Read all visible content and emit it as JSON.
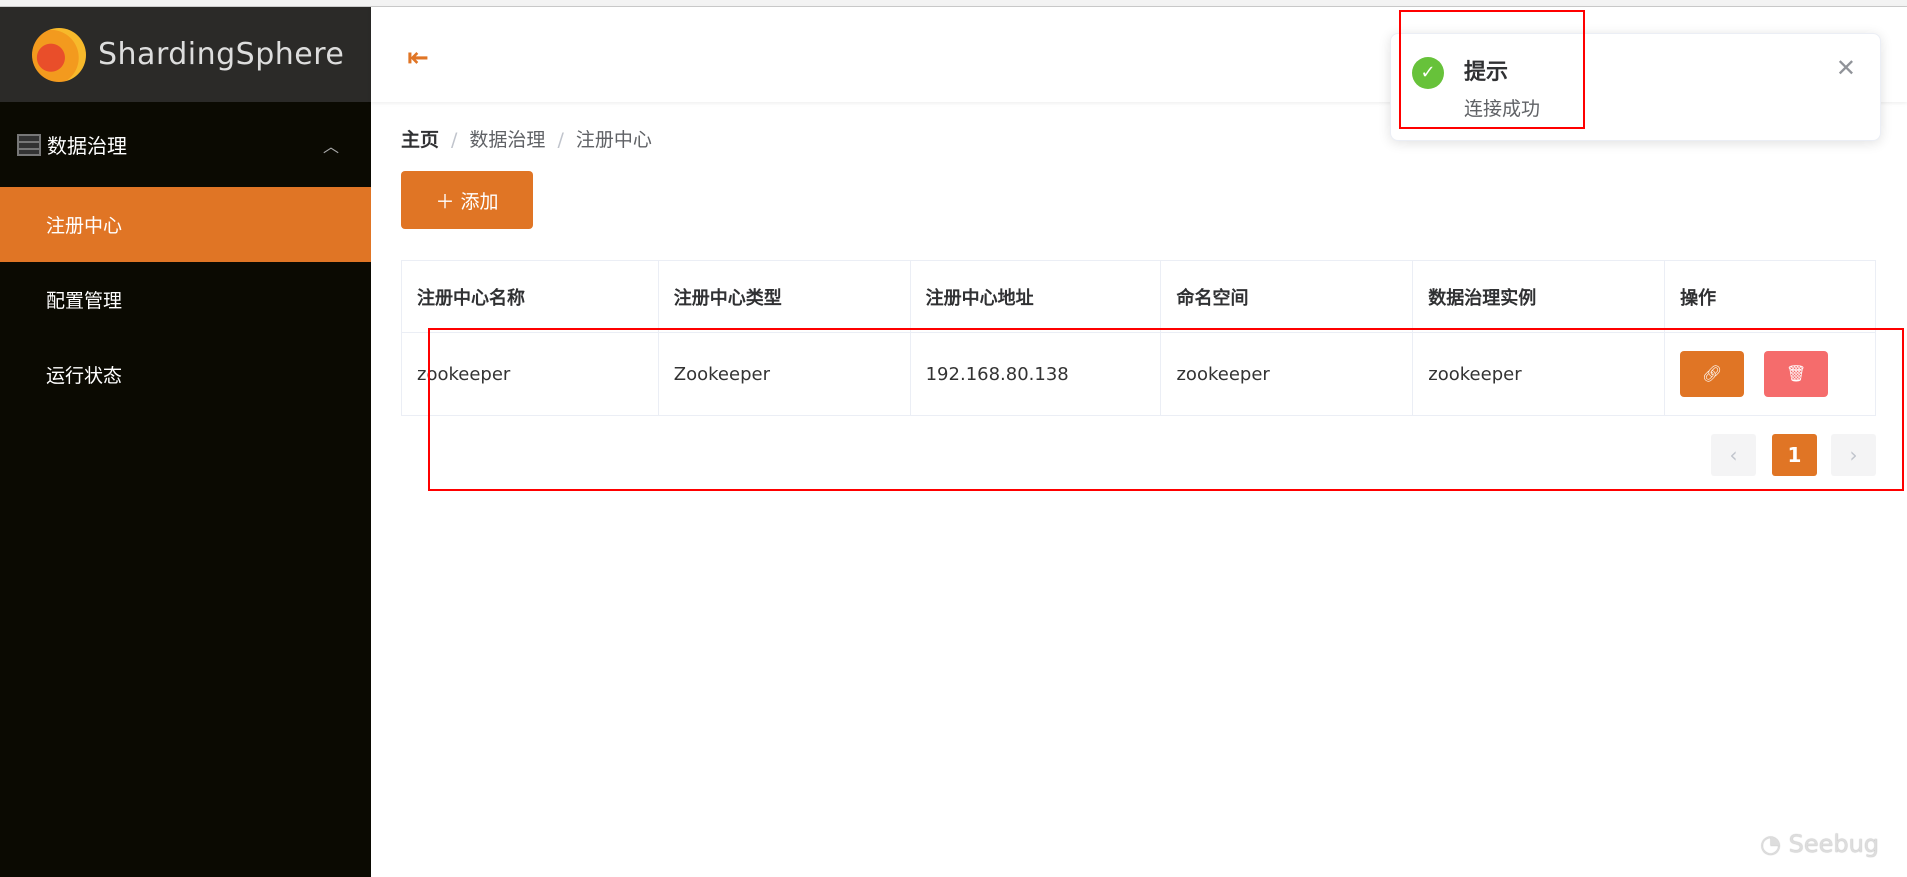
{
  "brand": {
    "name": "ShardingSphere"
  },
  "sidebar": {
    "group": "数据治理",
    "items": [
      {
        "label": "注册中心",
        "active": true
      },
      {
        "label": "配置管理"
      },
      {
        "label": "运行状态"
      }
    ]
  },
  "breadcrumb": [
    "主页",
    "数据治理",
    "注册中心"
  ],
  "toolbar": {
    "add_label": "添加"
  },
  "table": {
    "headers": [
      "注册中心名称",
      "注册中心类型",
      "注册中心地址",
      "命名空间",
      "数据治理实例",
      "操作"
    ],
    "rows": [
      [
        "zookeeper",
        "Zookeeper",
        "192.168.80.138",
        "zookeeper",
        "zookeeper"
      ]
    ]
  },
  "pagination": {
    "current": "1"
  },
  "notification": {
    "title": "提示",
    "message": "连接成功"
  },
  "watermark": "Seebug",
  "colors": {
    "accent": "#e07525",
    "danger": "#f56c6c",
    "success": "#67c23a"
  }
}
